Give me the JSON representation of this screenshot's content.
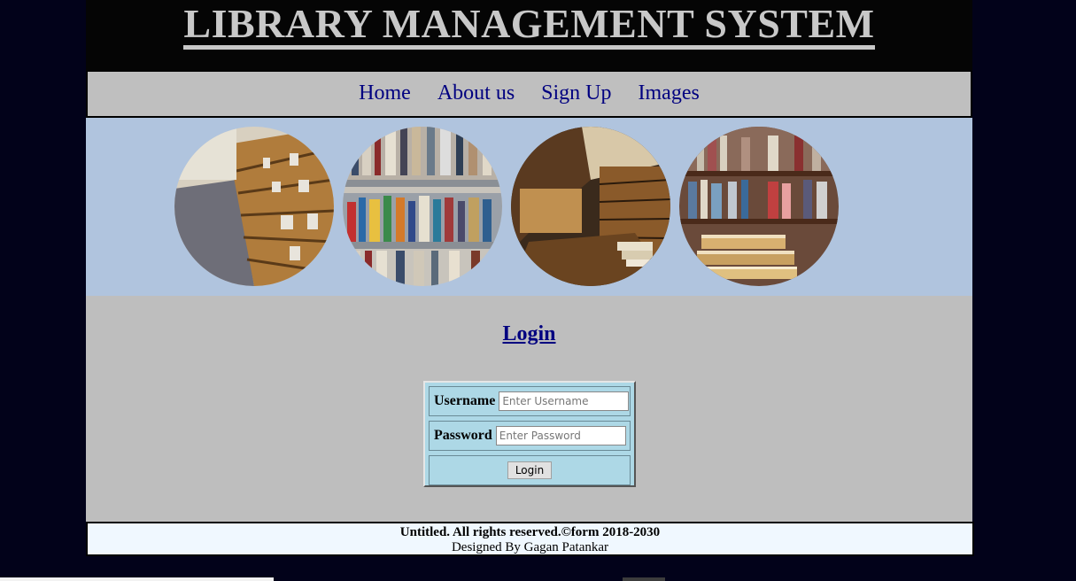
{
  "header": {
    "title": "LIBRARY MANAGEMENT SYSTEM"
  },
  "nav": {
    "items": [
      {
        "label": "Home"
      },
      {
        "label": "About us"
      },
      {
        "label": "Sign Up"
      },
      {
        "label": "Images"
      }
    ]
  },
  "banner": {
    "images": [
      "library-aisle-image",
      "bookshelf-closeup-image",
      "library-hall-image",
      "book-stack-image"
    ]
  },
  "login": {
    "heading": "Login",
    "username_label": "Username",
    "username_placeholder": "Enter Username",
    "password_label": "Password",
    "password_placeholder": "Enter Password",
    "button_label": "Login"
  },
  "footer": {
    "copyright": "Untitled. All rights reserved.©form 2018-2030",
    "designed_by": "Designed By Gagan Patankar"
  },
  "colors": {
    "page_background": "#02021a",
    "header_background": "#050505",
    "nav_background": "#bfbfbf",
    "nav_link": "#000080",
    "banner_background": "#b0c4de",
    "main_background": "#bebebe",
    "login_box": "#add8e6",
    "footer_background": "#f0f8ff"
  }
}
